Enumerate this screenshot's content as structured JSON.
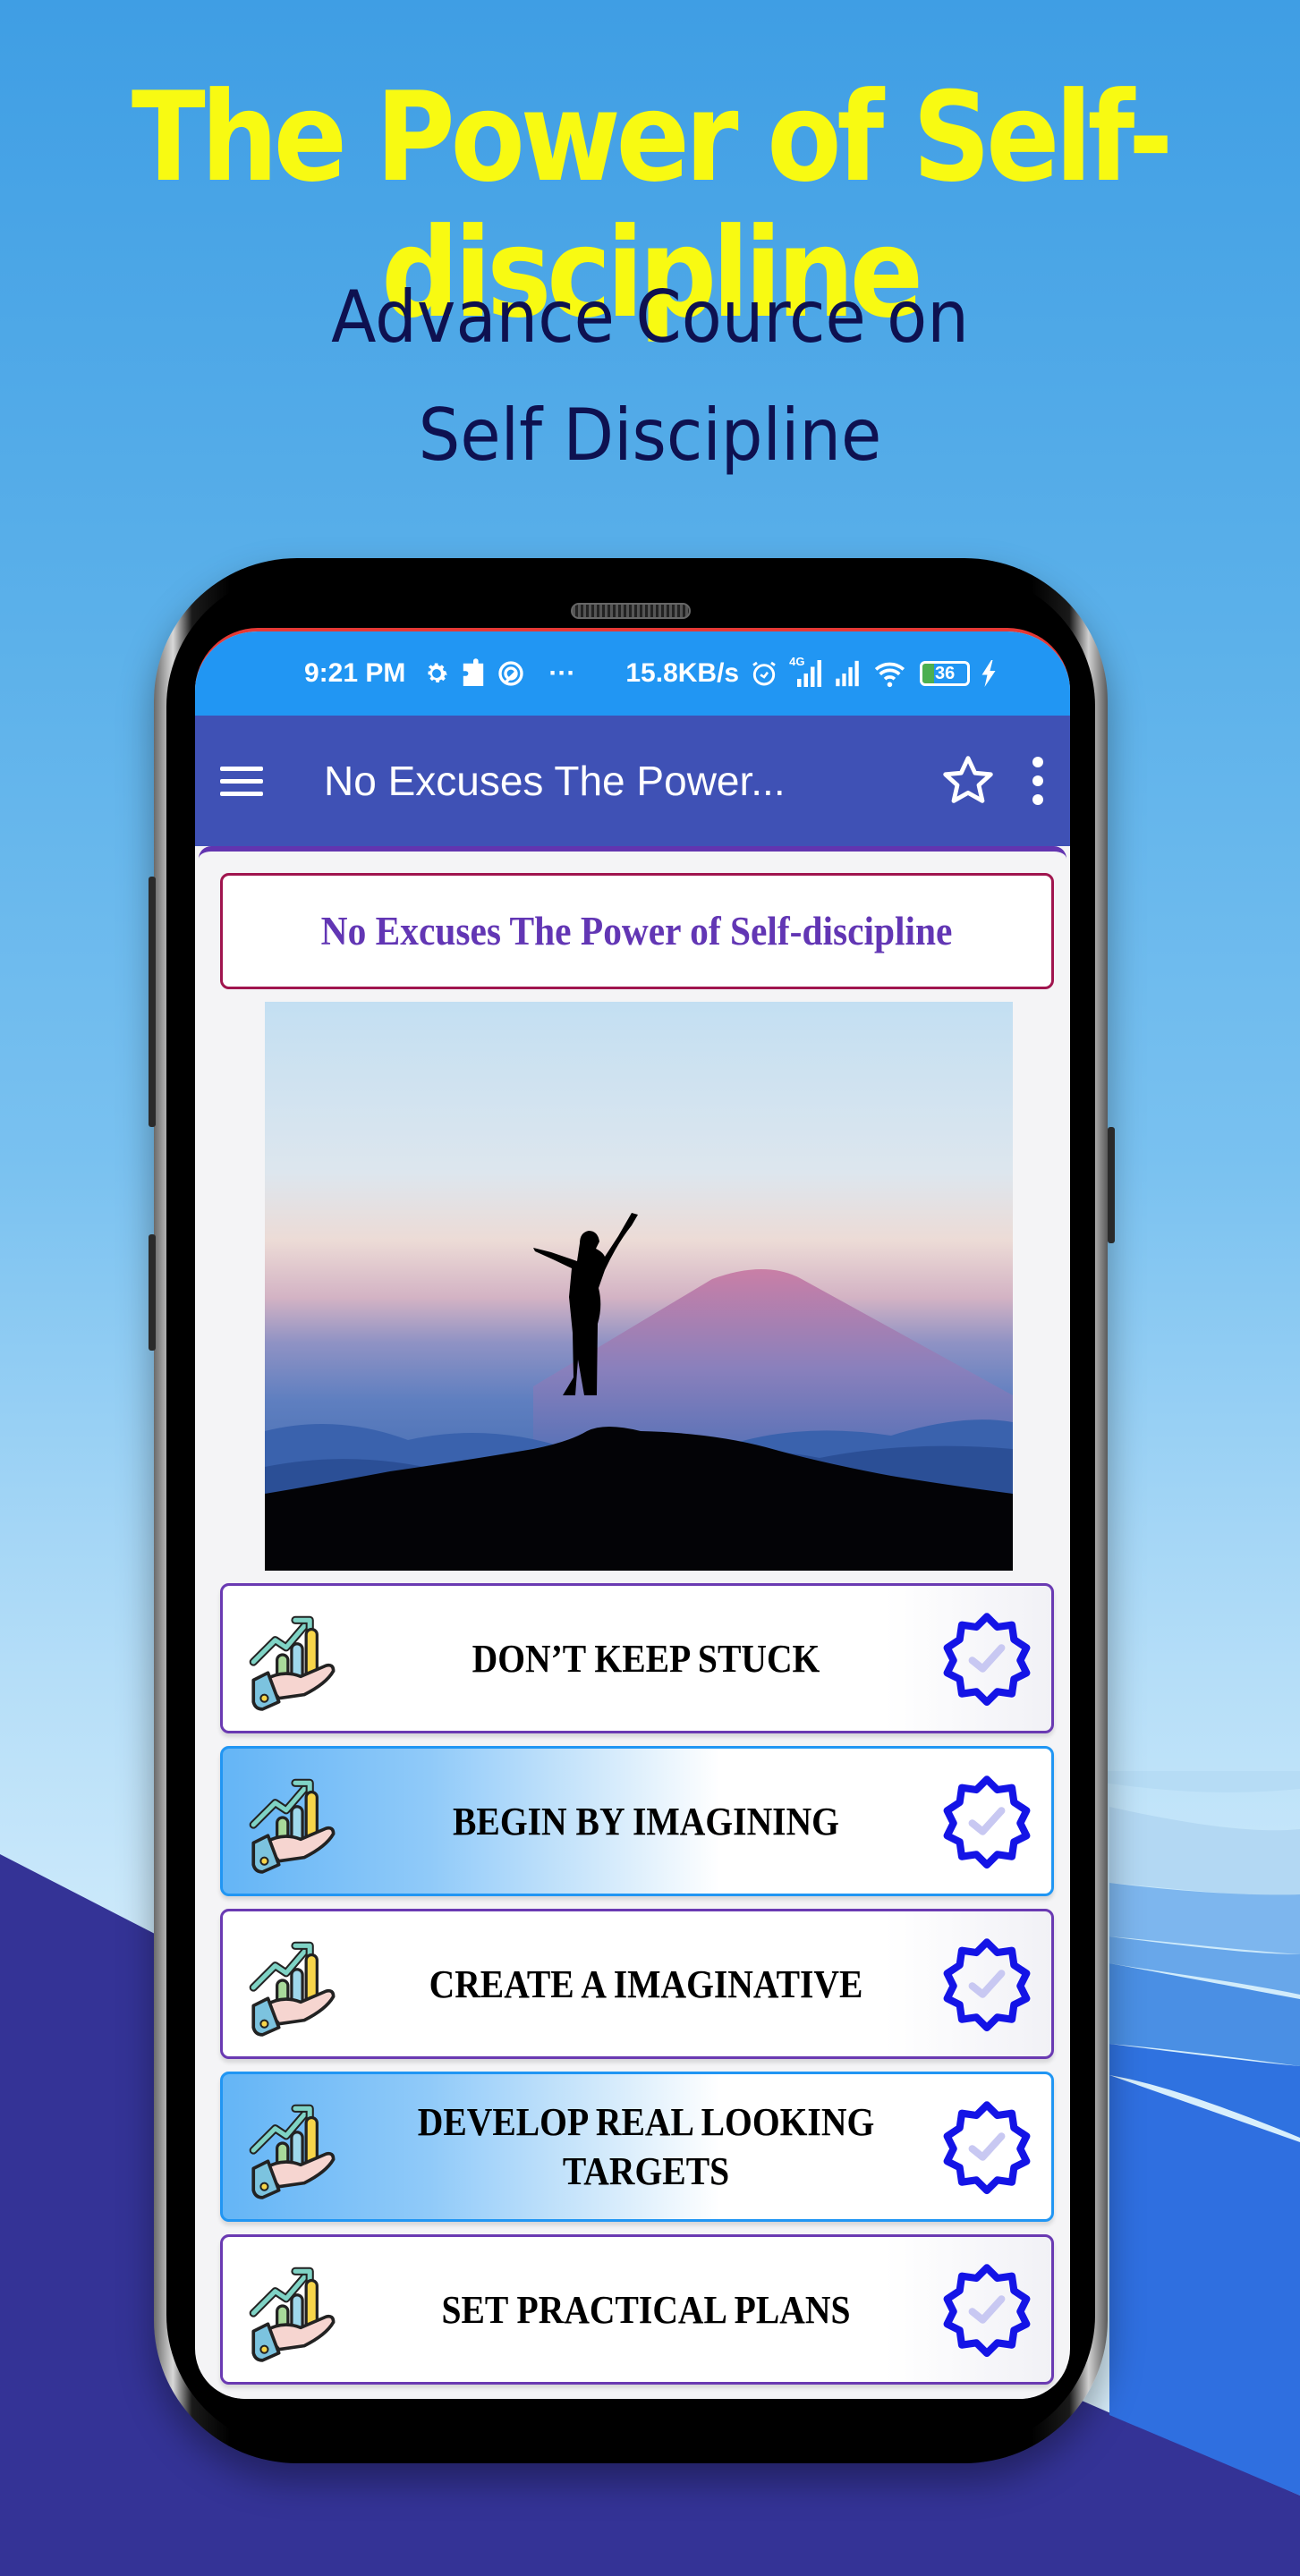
{
  "promo": {
    "title": "The Power of Self-discipline",
    "subtitle_line1": "Advance Cource on",
    "subtitle_line2": "Self Discipline"
  },
  "status_bar": {
    "time": "9:21 PM",
    "network_speed": "15.8KB/s",
    "network_type": "4G",
    "battery_level": "36",
    "icons": [
      "gear-icon",
      "puzzle-icon",
      "sync-icon",
      "more-dots-icon",
      "alarm-icon",
      "signal-icon",
      "signal-icon",
      "wifi-icon",
      "battery-icon",
      "charging-icon"
    ]
  },
  "toolbar": {
    "title": "No Excuses The Power...",
    "menu_icon": "hamburger-icon",
    "favorite_icon": "star-icon",
    "overflow_icon": "kebab-menu-icon"
  },
  "content": {
    "heading": "No Excuses The Power of Self-discipline",
    "hero_image_alt": "Silhouette of person with raised arms on mountain at sunrise",
    "chapters": [
      {
        "label": "DON’T KEEP STUCK",
        "style": "plain"
      },
      {
        "label": "BEGIN BY IMAGINING",
        "style": "blue"
      },
      {
        "label": "CREATE A IMAGINATIVE",
        "style": "plain"
      },
      {
        "label": "DEVELOP REAL LOOKING TARGETS",
        "style": "blue"
      },
      {
        "label": "SET PRACTICAL PLANS",
        "style": "plain"
      }
    ]
  },
  "colors": {
    "title_yellow": "#f8fa12",
    "subtitle_navy": "#0e1150",
    "statusbar_blue": "#2196f3",
    "toolbar_indigo": "#3f51b5",
    "heading_purple": "#6236b4",
    "heading_border": "#a0154e",
    "badge_blue": "#1414e6"
  }
}
